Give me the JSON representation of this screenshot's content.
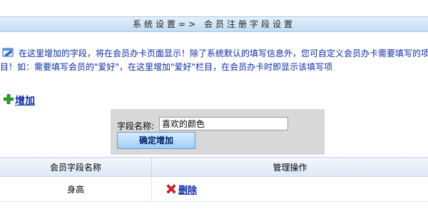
{
  "header": {
    "title": "系统设置=> 会员注册字段设置"
  },
  "notice": {
    "line1": "在这里增加的字段，将在会员办卡页面显示！除了系统默认的填写信息外，您可自定义会员办卡需要填写的项",
    "line2": "目！如：需要填写会员的\"爱好\"，在这里增加\"爱好\"栏目，在会员办卡时即显示该填写项"
  },
  "add_link": {
    "label": "增加"
  },
  "add_form": {
    "field_label": "字段名称:",
    "field_value": "喜欢的颜色",
    "submit_label": "确定增加"
  },
  "table": {
    "columns": [
      "会员字段名称",
      "管理操作"
    ],
    "rows": [
      {
        "name": "身高",
        "action": "删除"
      }
    ]
  },
  "colors": {
    "accent": "#0a2aa8",
    "title_bar": "#c3dcf2",
    "form_bg": "#d8d8d8"
  }
}
